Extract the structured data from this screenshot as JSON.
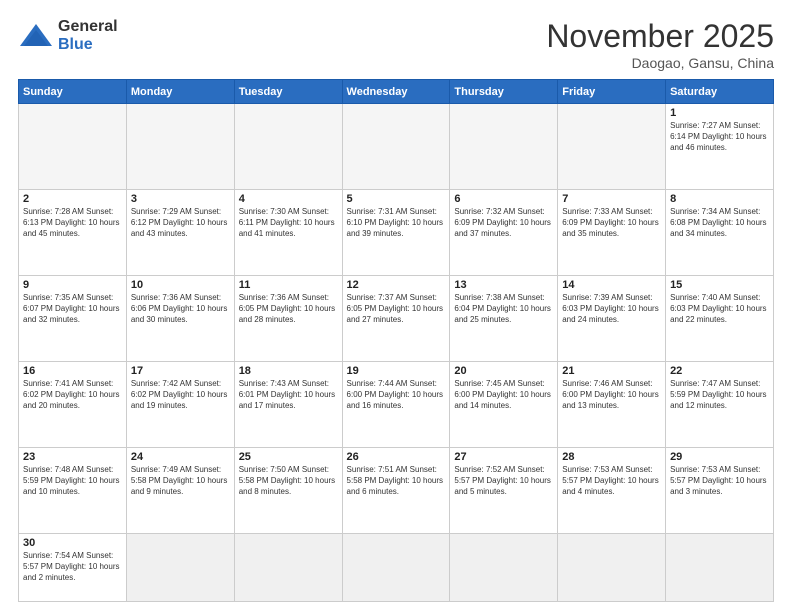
{
  "header": {
    "logo_general": "General",
    "logo_blue": "Blue",
    "month_title": "November 2025",
    "location": "Daogao, Gansu, China"
  },
  "days_of_week": [
    "Sunday",
    "Monday",
    "Tuesday",
    "Wednesday",
    "Thursday",
    "Friday",
    "Saturday"
  ],
  "weeks": [
    [
      {
        "day": "",
        "info": ""
      },
      {
        "day": "",
        "info": ""
      },
      {
        "day": "",
        "info": ""
      },
      {
        "day": "",
        "info": ""
      },
      {
        "day": "",
        "info": ""
      },
      {
        "day": "",
        "info": ""
      },
      {
        "day": "1",
        "info": "Sunrise: 7:27 AM\nSunset: 6:14 PM\nDaylight: 10 hours and 46 minutes."
      }
    ],
    [
      {
        "day": "2",
        "info": "Sunrise: 7:28 AM\nSunset: 6:13 PM\nDaylight: 10 hours and 45 minutes."
      },
      {
        "day": "3",
        "info": "Sunrise: 7:29 AM\nSunset: 6:12 PM\nDaylight: 10 hours and 43 minutes."
      },
      {
        "day": "4",
        "info": "Sunrise: 7:30 AM\nSunset: 6:11 PM\nDaylight: 10 hours and 41 minutes."
      },
      {
        "day": "5",
        "info": "Sunrise: 7:31 AM\nSunset: 6:10 PM\nDaylight: 10 hours and 39 minutes."
      },
      {
        "day": "6",
        "info": "Sunrise: 7:32 AM\nSunset: 6:09 PM\nDaylight: 10 hours and 37 minutes."
      },
      {
        "day": "7",
        "info": "Sunrise: 7:33 AM\nSunset: 6:09 PM\nDaylight: 10 hours and 35 minutes."
      },
      {
        "day": "8",
        "info": "Sunrise: 7:34 AM\nSunset: 6:08 PM\nDaylight: 10 hours and 34 minutes."
      }
    ],
    [
      {
        "day": "9",
        "info": "Sunrise: 7:35 AM\nSunset: 6:07 PM\nDaylight: 10 hours and 32 minutes."
      },
      {
        "day": "10",
        "info": "Sunrise: 7:36 AM\nSunset: 6:06 PM\nDaylight: 10 hours and 30 minutes."
      },
      {
        "day": "11",
        "info": "Sunrise: 7:36 AM\nSunset: 6:05 PM\nDaylight: 10 hours and 28 minutes."
      },
      {
        "day": "12",
        "info": "Sunrise: 7:37 AM\nSunset: 6:05 PM\nDaylight: 10 hours and 27 minutes."
      },
      {
        "day": "13",
        "info": "Sunrise: 7:38 AM\nSunset: 6:04 PM\nDaylight: 10 hours and 25 minutes."
      },
      {
        "day": "14",
        "info": "Sunrise: 7:39 AM\nSunset: 6:03 PM\nDaylight: 10 hours and 24 minutes."
      },
      {
        "day": "15",
        "info": "Sunrise: 7:40 AM\nSunset: 6:03 PM\nDaylight: 10 hours and 22 minutes."
      }
    ],
    [
      {
        "day": "16",
        "info": "Sunrise: 7:41 AM\nSunset: 6:02 PM\nDaylight: 10 hours and 20 minutes."
      },
      {
        "day": "17",
        "info": "Sunrise: 7:42 AM\nSunset: 6:02 PM\nDaylight: 10 hours and 19 minutes."
      },
      {
        "day": "18",
        "info": "Sunrise: 7:43 AM\nSunset: 6:01 PM\nDaylight: 10 hours and 17 minutes."
      },
      {
        "day": "19",
        "info": "Sunrise: 7:44 AM\nSunset: 6:00 PM\nDaylight: 10 hours and 16 minutes."
      },
      {
        "day": "20",
        "info": "Sunrise: 7:45 AM\nSunset: 6:00 PM\nDaylight: 10 hours and 14 minutes."
      },
      {
        "day": "21",
        "info": "Sunrise: 7:46 AM\nSunset: 6:00 PM\nDaylight: 10 hours and 13 minutes."
      },
      {
        "day": "22",
        "info": "Sunrise: 7:47 AM\nSunset: 5:59 PM\nDaylight: 10 hours and 12 minutes."
      }
    ],
    [
      {
        "day": "23",
        "info": "Sunrise: 7:48 AM\nSunset: 5:59 PM\nDaylight: 10 hours and 10 minutes."
      },
      {
        "day": "24",
        "info": "Sunrise: 7:49 AM\nSunset: 5:58 PM\nDaylight: 10 hours and 9 minutes."
      },
      {
        "day": "25",
        "info": "Sunrise: 7:50 AM\nSunset: 5:58 PM\nDaylight: 10 hours and 8 minutes."
      },
      {
        "day": "26",
        "info": "Sunrise: 7:51 AM\nSunset: 5:58 PM\nDaylight: 10 hours and 6 minutes."
      },
      {
        "day": "27",
        "info": "Sunrise: 7:52 AM\nSunset: 5:57 PM\nDaylight: 10 hours and 5 minutes."
      },
      {
        "day": "28",
        "info": "Sunrise: 7:53 AM\nSunset: 5:57 PM\nDaylight: 10 hours and 4 minutes."
      },
      {
        "day": "29",
        "info": "Sunrise: 7:53 AM\nSunset: 5:57 PM\nDaylight: 10 hours and 3 minutes."
      }
    ],
    [
      {
        "day": "30",
        "info": "Sunrise: 7:54 AM\nSunset: 5:57 PM\nDaylight: 10 hours and 2 minutes."
      },
      {
        "day": "",
        "info": ""
      },
      {
        "day": "",
        "info": ""
      },
      {
        "day": "",
        "info": ""
      },
      {
        "day": "",
        "info": ""
      },
      {
        "day": "",
        "info": ""
      },
      {
        "day": "",
        "info": ""
      }
    ]
  ]
}
